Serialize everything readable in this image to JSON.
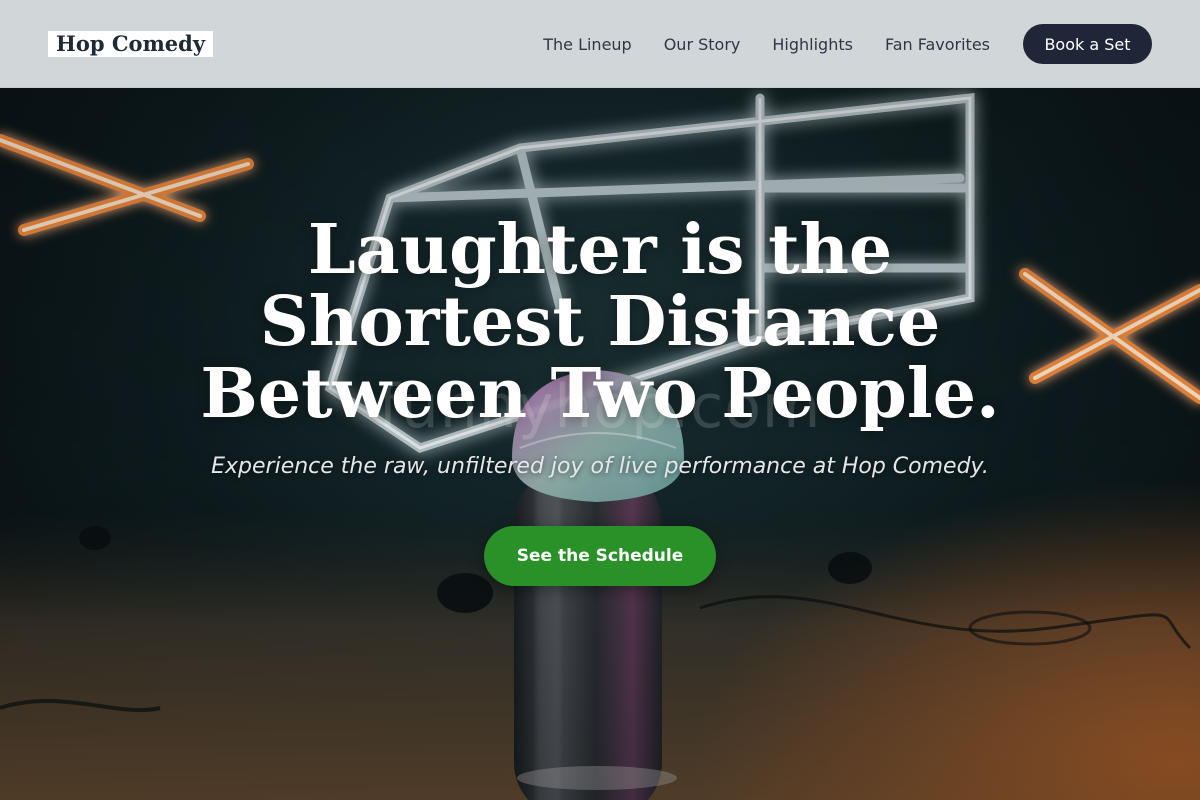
{
  "brand": {
    "name": "Hop Comedy"
  },
  "nav": {
    "links": [
      {
        "label": "The Lineup"
      },
      {
        "label": "Our Story"
      },
      {
        "label": "Highlights"
      },
      {
        "label": "Fan Favorites"
      }
    ],
    "cta_label": "Book a Set"
  },
  "hero": {
    "headline": "Laughter is the Shortest Distance Between Two People.",
    "subheadline": "Experience the raw, unfiltered joy of live performance at Hop Comedy.",
    "cta_label": "See the Schedule",
    "watermark": "funnyhop.com"
  },
  "colors": {
    "nav_bg": "#dee2e5",
    "nav_button": "#1e2637",
    "cta_green": "#2a9129",
    "text_light": "#ffffff"
  }
}
